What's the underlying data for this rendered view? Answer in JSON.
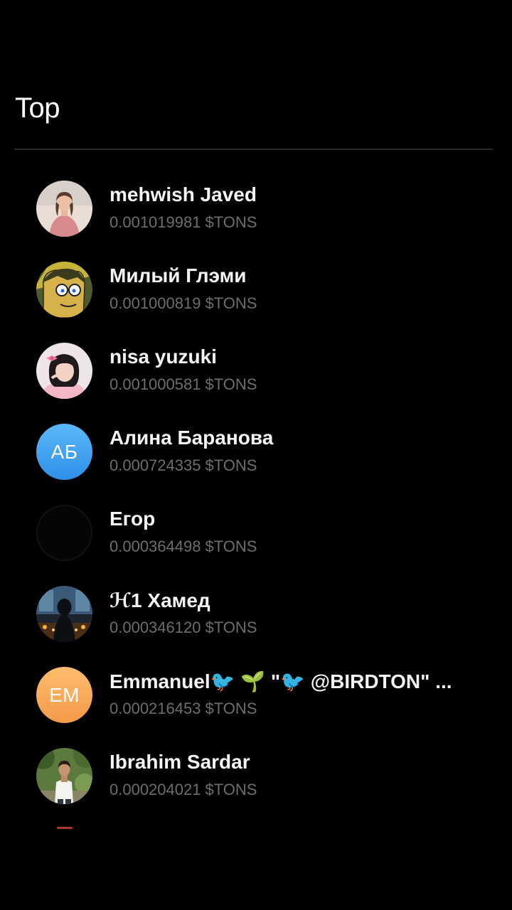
{
  "header": {
    "title": "Top"
  },
  "leaderboard": {
    "currency": "$TONS",
    "entries": [
      {
        "name": "mehwish Javed",
        "amount": "0.001019981",
        "avatar": "photo-woman-pink-dress"
      },
      {
        "name": "Милый Глэми",
        "amount": "0.001000819",
        "avatar": "photo-cartoon-character"
      },
      {
        "name": "nisa yuzuki",
        "amount": "0.001000581",
        "avatar": "photo-girl-pink-bow"
      },
      {
        "name": "Алина Баранова",
        "amount": "0.000724335",
        "avatar": "initials",
        "initials": "АБ",
        "avatar_color": "#3a9cf0"
      },
      {
        "name": "Егор",
        "amount": "0.000364498",
        "avatar": "empty-dark"
      },
      {
        "name": "ℋ1 Хамед",
        "amount": "0.000346120",
        "avatar": "photo-hooded-figure-dark-room"
      },
      {
        "name": "Emmanuel🐦 🌱 \"🐦 @BIRDTON\" ...",
        "amount": "0.000216453",
        "avatar": "initials",
        "initials": "EM",
        "avatar_color": "#f5a75a"
      },
      {
        "name": "Ibrahim Sardar",
        "amount": "0.000204021",
        "avatar": "photo-man-white-shirt-trees"
      }
    ]
  },
  "colors": {
    "background": "#000000",
    "name_text": "#f4f4f4",
    "amount_text": "#6d6d6d",
    "divider": "#2a2a2a"
  }
}
